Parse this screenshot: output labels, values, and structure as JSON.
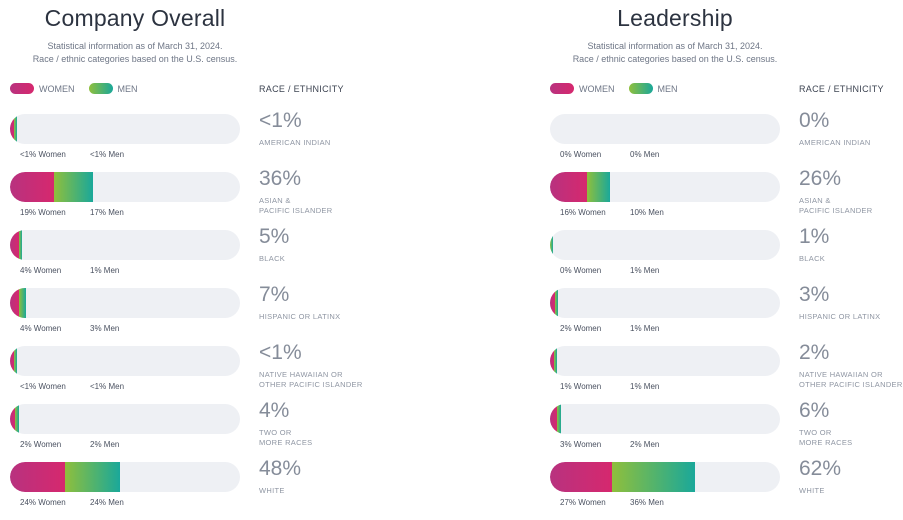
{
  "legend": {
    "women": "WOMEN",
    "men": "MEN",
    "race_header": "RACE / ETHNICITY"
  },
  "colors": {
    "women": "#d6286e",
    "men": "#1aa89a",
    "track": "#eef0f4"
  },
  "chart_data": [
    {
      "type": "bar",
      "title": "Company Overall",
      "subtitle": [
        "Statistical information as of March 31, 2024.",
        "Race / ethnic categories based on the U.S. census."
      ],
      "xlim": [
        0,
        100
      ],
      "rows": [
        {
          "total": "<1%",
          "category": "AMERICAN INDIAN",
          "women_label": "<1% Women",
          "men_label": "<1% Men",
          "women": 0.5,
          "men": 0.5
        },
        {
          "total": "36%",
          "category": "ASIAN &\nPACIFIC ISLANDER",
          "women_label": "19% Women",
          "men_label": "17% Men",
          "women": 19,
          "men": 17
        },
        {
          "total": "5%",
          "category": "BLACK",
          "women_label": "4% Women",
          "men_label": "1% Men",
          "women": 4,
          "men": 1
        },
        {
          "total": "7%",
          "category": "HISPANIC OR LATINX",
          "women_label": "4% Women",
          "men_label": "3% Men",
          "women": 4,
          "men": 3
        },
        {
          "total": "<1%",
          "category": "NATIVE HAWAIIAN OR\nOTHER PACIFIC ISLANDER",
          "women_label": "<1% Women",
          "men_label": "<1% Men",
          "women": 0.5,
          "men": 0.5
        },
        {
          "total": "4%",
          "category": "TWO OR\nMORE RACES",
          "women_label": "2% Women",
          "men_label": "2% Men",
          "women": 2,
          "men": 2
        },
        {
          "total": "48%",
          "category": "WHITE",
          "women_label": "24% Women",
          "men_label": "24% Men",
          "women": 24,
          "men": 24
        }
      ]
    },
    {
      "type": "bar",
      "title": "Leadership",
      "subtitle": [
        "Statistical information as of March 31, 2024.",
        "Race / ethnic categories based on the U.S. census."
      ],
      "xlim": [
        0,
        100
      ],
      "rows": [
        {
          "total": "0%",
          "category": "AMERICAN INDIAN",
          "women_label": "0% Women",
          "men_label": "0% Men",
          "women": 0,
          "men": 0
        },
        {
          "total": "26%",
          "category": "ASIAN &\nPACIFIC ISLANDER",
          "women_label": "16% Women",
          "men_label": "10% Men",
          "women": 16,
          "men": 10
        },
        {
          "total": "1%",
          "category": "BLACK",
          "women_label": "0% Women",
          "men_label": "1% Men",
          "women": 0,
          "men": 1
        },
        {
          "total": "3%",
          "category": "HISPANIC OR LATINX",
          "women_label": "2% Women",
          "men_label": "1% Men",
          "women": 2,
          "men": 1
        },
        {
          "total": "2%",
          "category": "NATIVE HAWAIIAN OR\nOTHER PACIFIC ISLANDER",
          "women_label": "1% Women",
          "men_label": "1% Men",
          "women": 1,
          "men": 1
        },
        {
          "total": "6%",
          "category": "TWO OR\nMORE RACES",
          "women_label": "3% Women",
          "men_label": "2% Men",
          "women": 3,
          "men": 2
        },
        {
          "total": "62%",
          "category": "WHITE",
          "women_label": "27% Women",
          "men_label": "36% Men",
          "women": 27,
          "men": 36
        }
      ]
    }
  ]
}
